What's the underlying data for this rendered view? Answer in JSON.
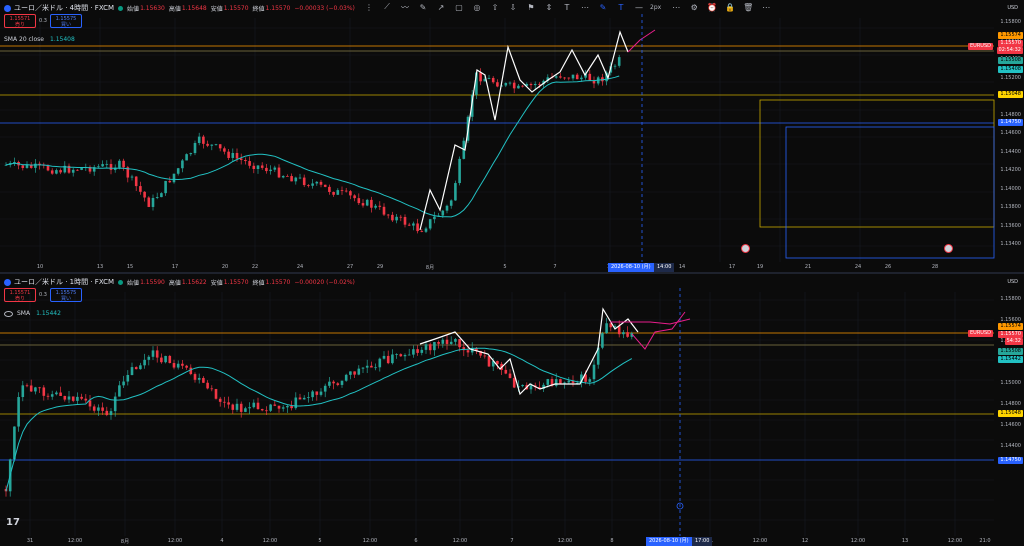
{
  "top": {
    "title": "ユーロ／米ドル · 4時間 · FXCM",
    "ohlc": [
      {
        "label": "始値",
        "value": "1.15630"
      },
      {
        "label": "高値",
        "value": "1.15648"
      },
      {
        "label": "安値",
        "value": "1.15570"
      },
      {
        "label": "終値",
        "value": "1.15570"
      }
    ],
    "change": "−0.00033 (−0.03%)",
    "sell_price": "1.15571",
    "sell_label": "売り",
    "spread": "0.3",
    "buy_price": "1.15575",
    "buy_label": "買い",
    "sma_label": "SMA 20 close",
    "sma_value": "1.15408",
    "currency": "USD",
    "symbol_tag": "EURUSD",
    "price_ticks": [
      "1.15800",
      "1.15600",
      "1.15400",
      "1.15200",
      "1.15000",
      "1.14800",
      "1.14600",
      "1.14400",
      "1.14200",
      "1.14000",
      "1.13800",
      "1.13600",
      "1.13400"
    ],
    "price_tags": [
      {
        "text": "1.15574",
        "color": "#ff9800"
      },
      {
        "text": "1.15570",
        "color": "#f23645"
      },
      {
        "text": "02:54:32",
        "color": "#f23645"
      },
      {
        "text": "1.15508",
        "color": "#26a69a"
      },
      {
        "text": "1.15408",
        "color": "#22c1c3"
      },
      {
        "text": "1.15048",
        "color": "#ffd400"
      },
      {
        "text": "1.14750",
        "color": "#2962ff"
      }
    ],
    "time_ticks": [
      "10",
      "13",
      "15",
      "17",
      "20",
      "22",
      "24",
      "27",
      "29",
      "8月",
      "5",
      "7",
      "12",
      "14",
      "17",
      "19",
      "21",
      "24",
      "26",
      "28"
    ],
    "cross_label": "2026-08-10 (月)",
    "cross_time": "14:00"
  },
  "bottom": {
    "title": "ユーロ／米ドル · 1時間 · FXCM",
    "ohlc": [
      {
        "label": "始値",
        "value": "1.15590"
      },
      {
        "label": "高値",
        "value": "1.15622"
      },
      {
        "label": "安値",
        "value": "1.15570"
      },
      {
        "label": "終値",
        "value": "1.15570"
      }
    ],
    "change": "−0.00020 (−0.02%)",
    "sell_price": "1.15571",
    "sell_label": "売り",
    "spread": "0.3",
    "buy_price": "1.15575",
    "buy_label": "買い",
    "sma_label": "SMA",
    "sma_value": "1.15442",
    "currency": "USD",
    "symbol_tag": "EURUSD",
    "price_ticks": [
      "1.15800",
      "1.15600",
      "1.15400",
      "1.15200",
      "1.15000",
      "1.14800",
      "1.14600",
      "1.14400"
    ],
    "price_tags": [
      {
        "text": "1.15574",
        "color": "#ff9800"
      },
      {
        "text": "1.15570",
        "color": "#f23645"
      },
      {
        "text": "54:32",
        "color": "#f23645"
      },
      {
        "text": "1.15508",
        "color": "#26a69a"
      },
      {
        "text": "1.15442",
        "color": "#22c1c3"
      },
      {
        "text": "1.15048",
        "color": "#ffd400"
      },
      {
        "text": "1.14750",
        "color": "#2962ff"
      }
    ],
    "time_ticks": [
      "31",
      "12:00",
      "8月",
      "12:00",
      "4",
      "12:00",
      "5",
      "12:00",
      "6",
      "12:00",
      "7",
      "12:00",
      "8",
      "12:00",
      "11",
      "12:00",
      "12",
      "12:00",
      "13",
      "12:00",
      "21:0"
    ],
    "cross_label": "2026-08-10 (月)",
    "cross_time": "17:00"
  },
  "toolbar": {
    "width_label": "2px"
  },
  "logo": "17",
  "colors": {
    "up": "#26a69a",
    "down": "#f23645",
    "sma": "#22c1c3",
    "draw": "#ffffff",
    "forecast": "#e91e8c",
    "yellow": "#c9a800",
    "blue": "#2962ff",
    "orange": "#ff9800"
  }
}
